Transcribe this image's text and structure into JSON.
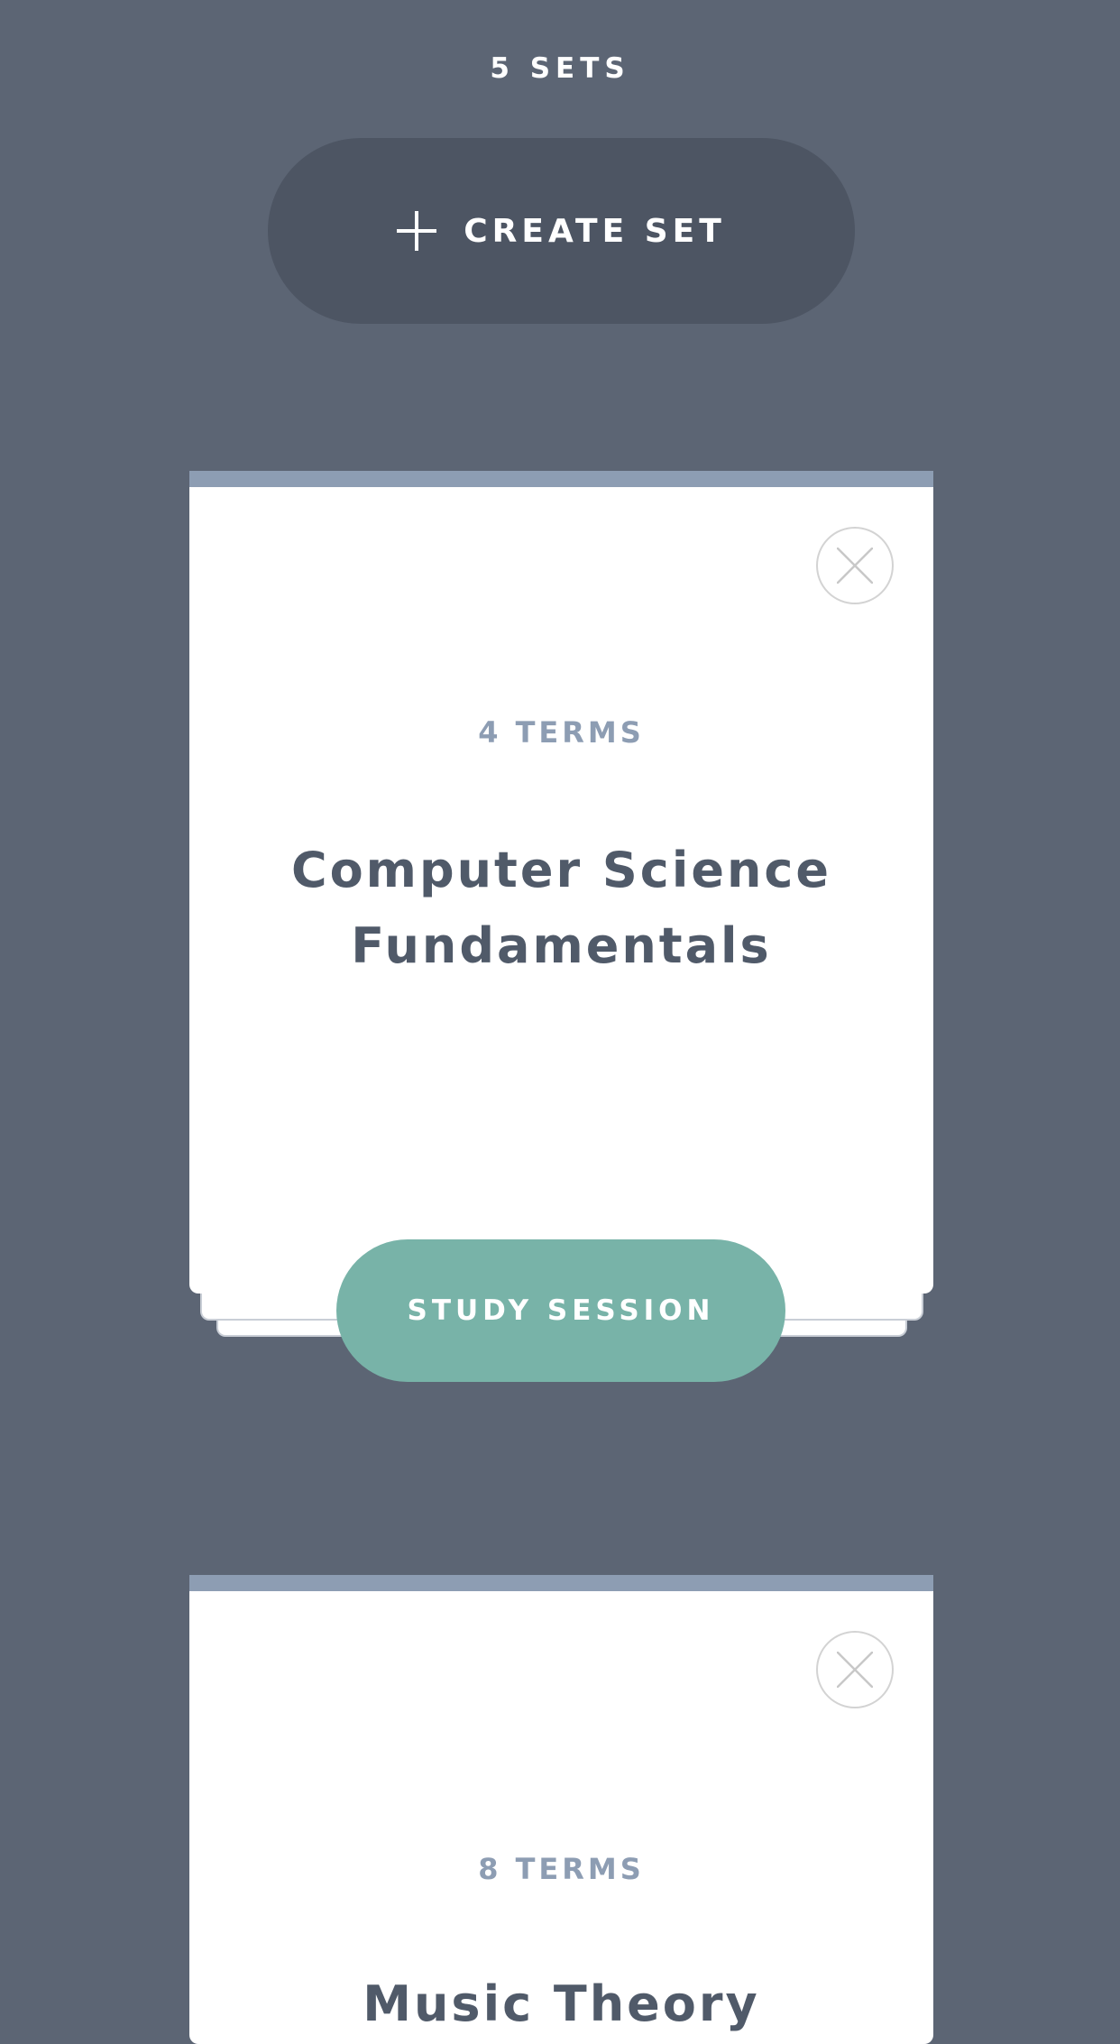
{
  "header": {
    "sets_count": "5 SETS",
    "create_label": "CREATE SET"
  },
  "sets": [
    {
      "terms": "4 TERMS",
      "title": "Computer Science Fundamentals",
      "study_label": "STUDY SESSION"
    },
    {
      "terms": "8 TERMS",
      "title": "Music Theory"
    }
  ],
  "colors": {
    "background": "#5c6574",
    "create_button": "#4d5563",
    "card_accent": "#8d9db3",
    "study_button": "#78b3a8"
  },
  "icons": {
    "create": "plus-icon",
    "delete": "close-icon"
  }
}
